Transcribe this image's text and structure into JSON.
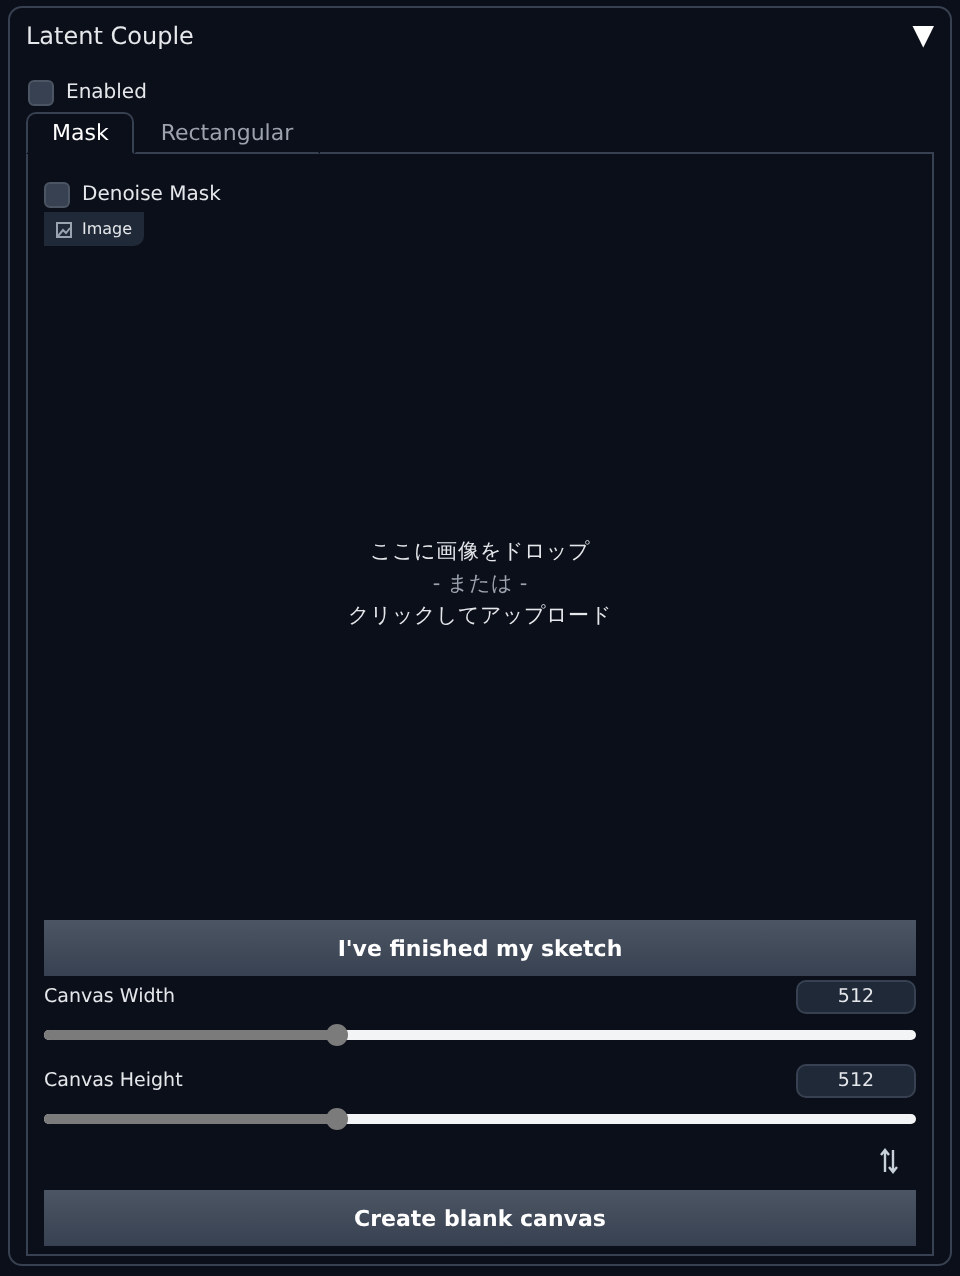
{
  "panel": {
    "title": "Latent Couple",
    "toggle": "▼",
    "expanded": true
  },
  "enabled": {
    "label": "Enabled",
    "checked": false
  },
  "tabs": [
    {
      "label": "Mask",
      "selected": true
    },
    {
      "label": "Rectangular",
      "selected": false
    }
  ],
  "denoise_mask": {
    "label": "Denoise Mask",
    "checked": false
  },
  "image_badge": "Image",
  "drop_area": {
    "line_1": "ここに画像をドロップ",
    "line_2": "- または -",
    "line_3": "クリックしてアップロード"
  },
  "finish_button": "I've finished my sketch",
  "sliders": [
    {
      "label": "Canvas Width",
      "value": "512",
      "level": 0.337
    },
    {
      "label": "Canvas Height",
      "value": "512",
      "level": 0.337
    }
  ],
  "create_button": "Create blank canvas"
}
